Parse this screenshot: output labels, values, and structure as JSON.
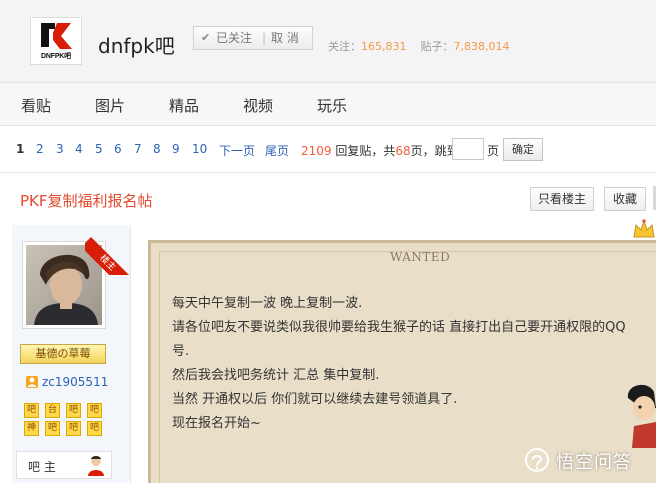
{
  "header": {
    "logo_text": "DNFPK吧",
    "forum_name": "dnfpk吧",
    "follow_label": "已关注",
    "unfollow_label": "取 消",
    "followers_label": "关注：",
    "followers_count": "165,831",
    "posts_label": "贴子：",
    "posts_count": "7,838,014"
  },
  "tabs": [
    "看贴",
    "图片",
    "精品",
    "视频",
    "玩乐"
  ],
  "pager": {
    "pages": [
      "1",
      "2",
      "3",
      "4",
      "5",
      "6",
      "7",
      "8",
      "9",
      "10"
    ],
    "current": "1",
    "next_label": "下一页",
    "last_label": "尾页",
    "reply_count": "2109",
    "reply_label": "回复贴，共",
    "page_count": "68",
    "page_suffix": "页，跳到",
    "jump_suffix": "页",
    "confirm_label": "确定"
  },
  "thread": {
    "title": "PKF复制福利报名帖",
    "only_op_label": "只看楼主",
    "favorite_label": "收藏"
  },
  "author": {
    "op_ribbon": "楼主",
    "rank_badge": "基德の草莓",
    "username": "zc1905511",
    "badges": [
      "吧",
      "台",
      "吧",
      "吧",
      "神",
      "吧",
      "吧",
      "吧"
    ],
    "role_label": "吧 主"
  },
  "post": {
    "wanted_label": "WANTED",
    "lines": [
      "每天中午复制一波 晚上复制一波.",
      "请各位吧友不要说类似我很帅要给我生猴子的话 直接打出自己要开通权限的QQ",
      "号.",
      "然后我会找吧务统计 汇总 集中复制.",
      "当然 开通权以后 你们就可以继续去建号领道具了.",
      "现在报名开始~"
    ]
  },
  "watermark": {
    "text": "悟空问答"
  },
  "colors": {
    "accent_red": "#e4492f",
    "link_blue": "#2d64b3",
    "stat_orange": "#f39a43",
    "poster_bg": "#e9dfc9"
  }
}
